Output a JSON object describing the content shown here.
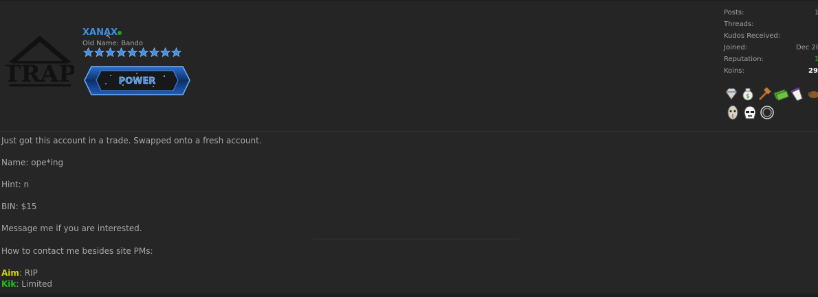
{
  "user": {
    "name": "XANAX",
    "old_name": "Old Name: Bando",
    "banner_text": "POWER",
    "avatar_text": "TRAP",
    "star_count": 9,
    "star_color": "#3d8fe6",
    "online_color": "#1fa51f"
  },
  "stats": [
    {
      "label": "Posts:",
      "value": "1"
    },
    {
      "label": "Threads:",
      "value": ""
    },
    {
      "label": "Kudos Received:",
      "value": ""
    },
    {
      "label": "Joined:",
      "value": "Dec 20"
    },
    {
      "label": "Reputation:",
      "value": "1"
    },
    {
      "label": "Koins:",
      "value": "29."
    }
  ],
  "awards": [
    "diamond-icon",
    "money-bag-icon",
    "gavel-icon",
    "cash-icon",
    "cup-icon",
    "bird-icon",
    "hockey-mask-icon",
    "stormtrooper-icon",
    "ring-icon"
  ],
  "post": {
    "line1": "Just got this account in a trade. Swapped onto a fresh account.",
    "line2": "Name: ope*ing",
    "line3": "Hint: n",
    "line4": "BIN: $15",
    "line5": "Message me if you are interested.",
    "line6": "How to contact me besides site PMs:",
    "aim_label": "Aim",
    "aim_value": ": RIP",
    "kik_label": "Kik",
    "kik_value": ": Limited"
  }
}
